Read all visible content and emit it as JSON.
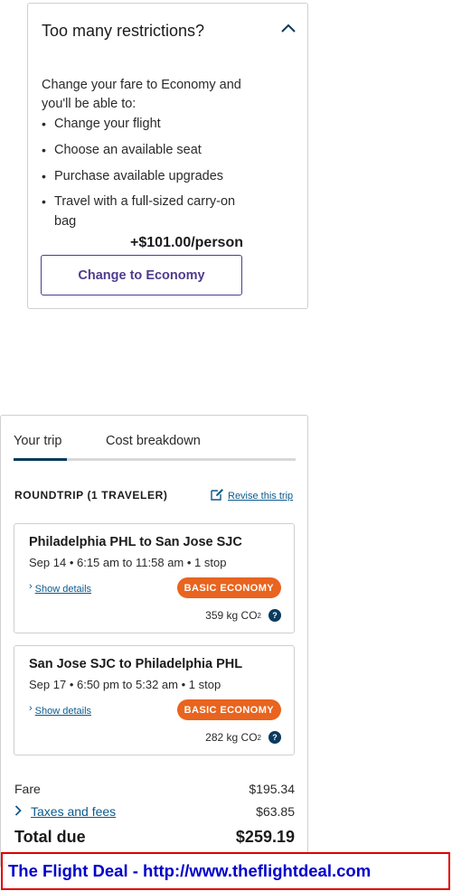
{
  "upsell": {
    "title": "Too many restrictions?",
    "lead": "Change your fare to Economy and you'll be able to:",
    "perks": [
      "Change your flight",
      "Choose an available seat",
      "Purchase available upgrades",
      "Travel with a full-sized carry-on bag"
    ],
    "price": "+$101.00/person",
    "button_label": "Change to Economy"
  },
  "summary": {
    "tabs": [
      {
        "label": "Your trip",
        "active": true
      },
      {
        "label": "Cost breakdown",
        "active": false
      }
    ],
    "heading": "ROUNDTRIP (1 TRAVELER)",
    "revise_label": "Revise this trip",
    "flights": [
      {
        "route": "Philadelphia PHL to San Jose SJC",
        "times": "Sep 14 • 6:15 am to 11:58 am • 1 stop",
        "show_details": "Show details",
        "fare_badge": "BASIC ECONOMY",
        "co2_value": "359 kg CO",
        "co2_sub": "2",
        "help": "?"
      },
      {
        "route": "San Jose SJC to Philadelphia PHL",
        "times": "Sep 17 • 6:50 pm to 5:32 am • 1 stop",
        "show_details": "Show details",
        "fare_badge": "BASIC ECONOMY",
        "co2_value": "282 kg CO",
        "co2_sub": "2",
        "help": "?"
      }
    ],
    "costs": {
      "fare_label": "Fare",
      "fare_amount": "$195.34",
      "taxes_label": "Taxes and fees",
      "taxes_amount": "$63.85",
      "total_label": "Total due",
      "total_amount": "$259.19"
    }
  },
  "banner": {
    "text": "The Flight Deal - http://www.theflightdeal.com"
  },
  "colors": {
    "accent_purple": "#4e3c8c",
    "link_blue": "#0b5a8c",
    "navy": "#0b3a5d",
    "badge_orange": "#e8641f",
    "banner_border": "#e00000",
    "banner_text": "#0000cc"
  }
}
